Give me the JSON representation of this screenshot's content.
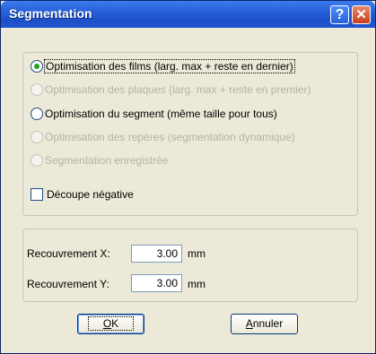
{
  "window": {
    "title": "Segmentation",
    "help_label": "?",
    "close_label": "✕"
  },
  "options": {
    "radios": [
      {
        "label": "Optimisation des films (larg. max + reste en dernier)",
        "selected": true,
        "enabled": true
      },
      {
        "label": "Optimisation des plaques (larg. max + reste en premier)",
        "selected": false,
        "enabled": false
      },
      {
        "label": "Optimisation du segment (même taille pour tous)",
        "selected": false,
        "enabled": true
      },
      {
        "label": "Optimisation des repères (segmentation dynamique)",
        "selected": false,
        "enabled": false
      },
      {
        "label": "Segmentation enregistrée",
        "selected": false,
        "enabled": false
      }
    ],
    "checkbox": {
      "label": "Découpe négative",
      "checked": false
    }
  },
  "overlap": {
    "x_label": "Recouvrement X:",
    "x_value": "3.00",
    "y_label": "Recouvrement Y:",
    "y_value": "3.00",
    "unit": "mm"
  },
  "buttons": {
    "ok_mnemonic": "O",
    "ok_rest": "K",
    "cancel_mnemonic": "A",
    "cancel_rest": "nnuler"
  },
  "colors": {
    "titlebar": "#2860d8",
    "dialog_bg": "#ece9d8",
    "radio_selected": "#21a121",
    "disabled_text": "#b5b2a7"
  }
}
